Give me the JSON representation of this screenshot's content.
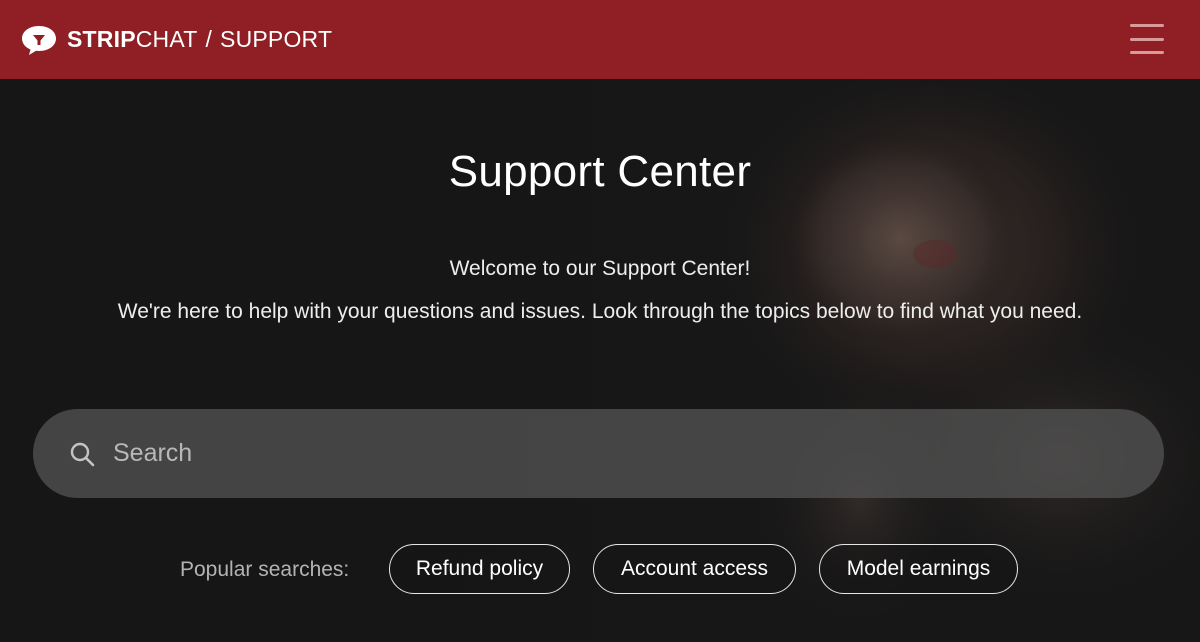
{
  "header": {
    "brand_strong": "STRIP",
    "brand_light": "CHAT",
    "brand_sep": "/",
    "brand_section": "SUPPORT",
    "logo_icon": "chat-bubble-logo-icon",
    "menu_icon": "hamburger-menu-icon",
    "bar_color": "#8f1f24"
  },
  "hero": {
    "title": "Support Center",
    "welcome": "Welcome to our Support Center!",
    "description": "We're here to help with your questions and issues. Look through the topics below to find what you need."
  },
  "search": {
    "icon": "search-icon",
    "placeholder": "Search",
    "value": ""
  },
  "popular": {
    "label": "Popular searches:",
    "chips": [
      "Refund policy",
      "Account access",
      "Model earnings"
    ]
  }
}
